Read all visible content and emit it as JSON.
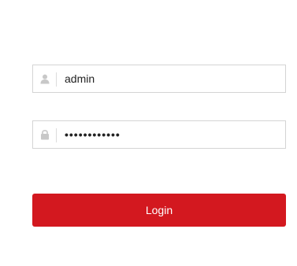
{
  "login_form": {
    "username": {
      "icon": "user-icon",
      "value": "admin"
    },
    "password": {
      "icon": "lock-icon",
      "value": "••••••••••••"
    },
    "login_label": "Login"
  },
  "colors": {
    "accent": "#d3181f",
    "field_border": "#d4d4d4",
    "icon": "#c8c8c8"
  }
}
